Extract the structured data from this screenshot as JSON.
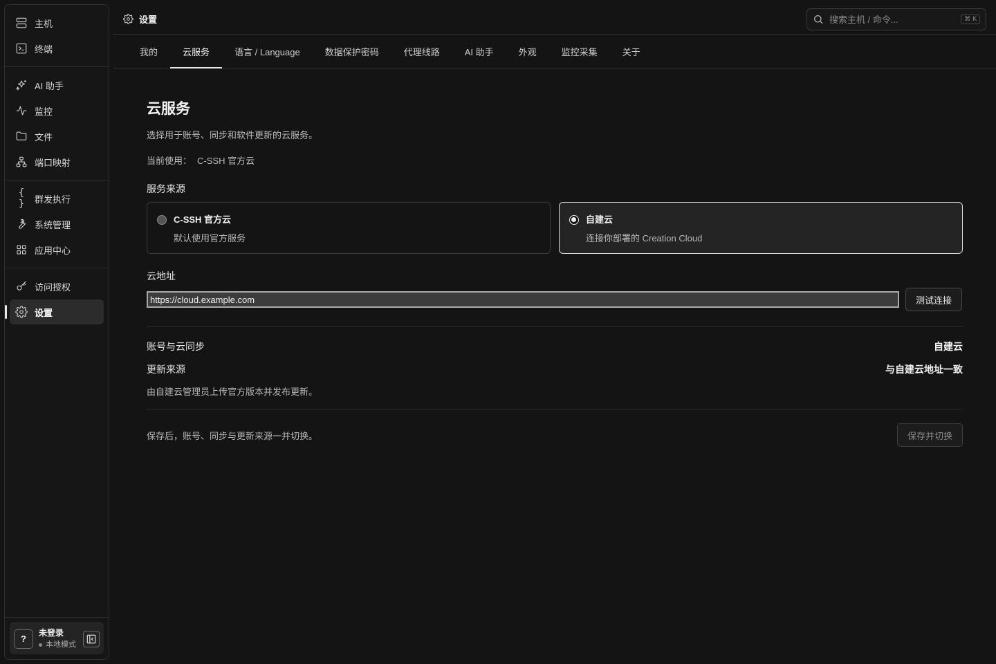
{
  "sidebar": {
    "groups": [
      [
        {
          "label": "主机",
          "icon": "server-icon"
        },
        {
          "label": "终端",
          "icon": "terminal-icon"
        }
      ],
      [
        {
          "label": "AI 助手",
          "icon": "sparkles-icon"
        },
        {
          "label": "监控",
          "icon": "activity-icon"
        },
        {
          "label": "文件",
          "icon": "folder-icon"
        },
        {
          "label": "端口映射",
          "icon": "network-icon"
        }
      ],
      [
        {
          "label": "群发执行",
          "icon": "braces-icon"
        },
        {
          "label": "系统管理",
          "icon": "wrench-icon"
        },
        {
          "label": "应用中心",
          "icon": "grid-icon"
        }
      ],
      [
        {
          "label": "访问授权",
          "icon": "key-icon"
        },
        {
          "label": "设置",
          "icon": "gear-icon",
          "active": true
        }
      ]
    ],
    "user": {
      "help": "?",
      "name": "未登录",
      "mode": "本地模式"
    }
  },
  "topbar": {
    "title": "设置",
    "search_placeholder": "搜索主机 / 命令...",
    "shortcut": "⌘ K"
  },
  "tabs": [
    {
      "label": "我的"
    },
    {
      "label": "云服务",
      "active": true
    },
    {
      "label": "语言 / Language"
    },
    {
      "label": "数据保护密码"
    },
    {
      "label": "代理线路"
    },
    {
      "label": "AI 助手"
    },
    {
      "label": "外观"
    },
    {
      "label": "监控采集"
    },
    {
      "label": "关于"
    }
  ],
  "main": {
    "title": "云服务",
    "description": "选择用于账号、同步和软件更新的云服务。",
    "current_label": "当前使用：",
    "current_value": "C-SSH 官方云",
    "source_label": "服务来源",
    "options": [
      {
        "title": "C-SSH 官方云",
        "subtitle": "默认使用官方服务",
        "selected": false
      },
      {
        "title": "自建云",
        "subtitle": "连接你部署的 Creation Cloud",
        "selected": true
      }
    ],
    "url_label": "云地址",
    "url_value": "https://cloud.example.com",
    "test_button": "测试连接",
    "sync_label": "账号与云同步",
    "sync_value": "自建云",
    "update_label": "更新来源",
    "update_value": "与自建云地址一致",
    "update_note": "由自建云管理员上传官方版本并发布更新。",
    "footer_note": "保存后，账号、同步与更新来源一并切换。",
    "save_button": "保存并切换"
  }
}
